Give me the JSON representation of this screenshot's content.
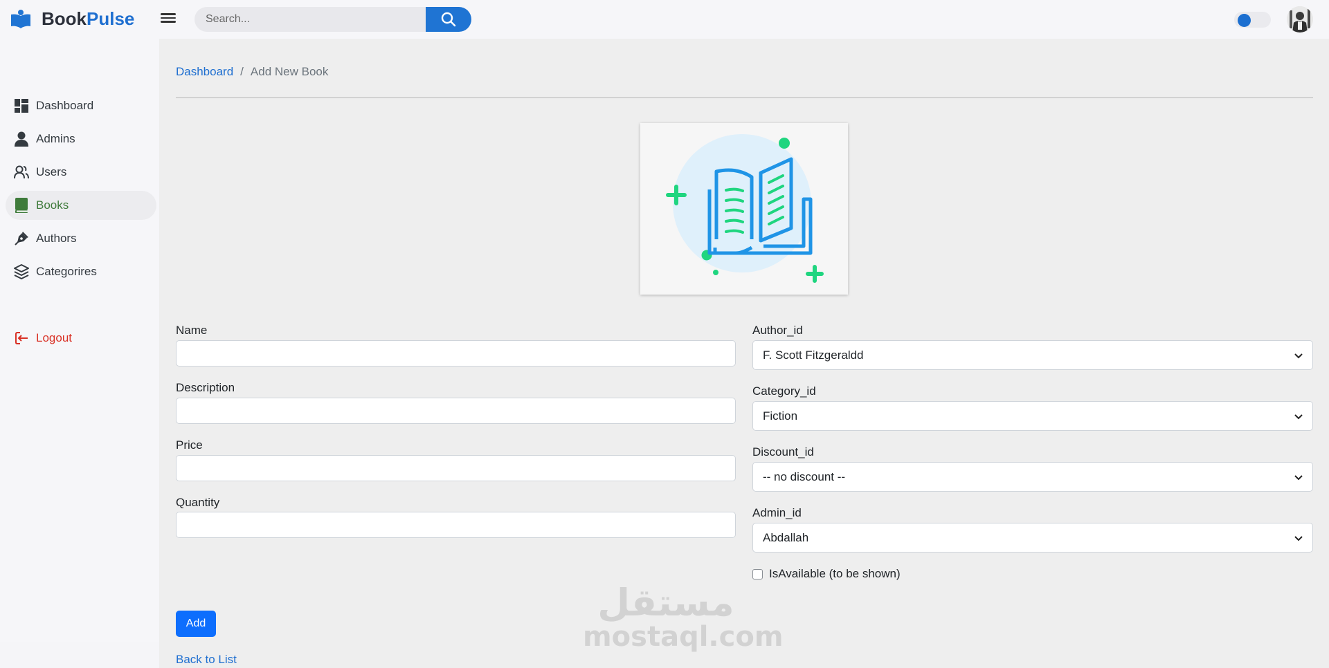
{
  "header": {
    "brand_part1": "Book",
    "brand_part2": "Pulse",
    "search_placeholder": "Search...",
    "accent_color": "#1f74d3"
  },
  "sidebar": {
    "items": [
      {
        "label": "Dashboard",
        "icon": "dashboard-icon"
      },
      {
        "label": "Admins",
        "icon": "admin-user-icon"
      },
      {
        "label": "Users",
        "icon": "users-icon"
      },
      {
        "label": "Books",
        "icon": "book-icon",
        "active": true
      },
      {
        "label": "Authors",
        "icon": "pen-nib-icon"
      },
      {
        "label": "Categorires",
        "icon": "layers-icon"
      }
    ],
    "logout": {
      "label": "Logout",
      "icon": "logout-icon"
    }
  },
  "breadcrumb": {
    "home": "Dashboard",
    "separator": "/",
    "current": "Add New Book"
  },
  "form": {
    "name": {
      "label": "Name",
      "value": ""
    },
    "description": {
      "label": "Description",
      "value": ""
    },
    "price": {
      "label": "Price",
      "value": ""
    },
    "quantity": {
      "label": "Quantity",
      "value": ""
    },
    "author": {
      "label": "Author_id",
      "selected": "F. Scott Fitzgeraldd"
    },
    "category": {
      "label": "Category_id",
      "selected": "Fiction"
    },
    "discount": {
      "label": "Discount_id",
      "selected": "-- no discount --"
    },
    "admin": {
      "label": "Admin_id",
      "selected": "Abdallah"
    },
    "available": {
      "label": "IsAvailable (to be shown)",
      "checked": false
    },
    "submit_label": "Add",
    "back_label": "Back to List"
  },
  "watermark": {
    "arabic": "مستقل",
    "latin": "mostaql.com"
  }
}
